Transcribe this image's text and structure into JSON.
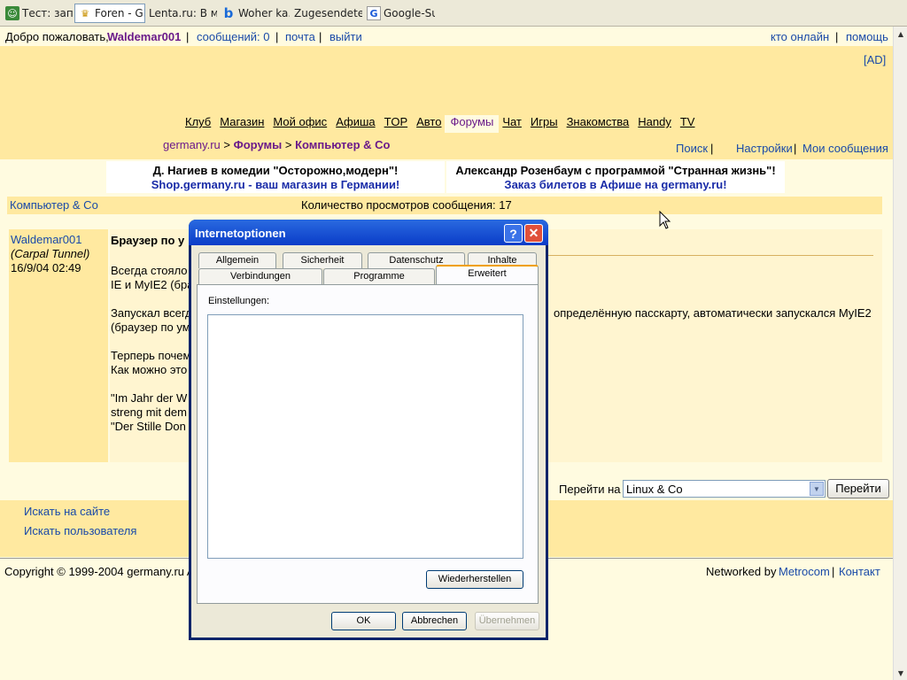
{
  "browser_tabs": [
    {
      "label": "Тест: зап...",
      "icon": "robot-icon"
    },
    {
      "label": "Foren - GE...",
      "icon": "crown-icon",
      "active": true
    },
    {
      "label": "Lenta.ru: В ми...",
      "icon": "blank-icon"
    },
    {
      "label": "Woher ka...",
      "icon": "b-icon"
    },
    {
      "label": "Zugesendete ...",
      "icon": "blank-icon"
    },
    {
      "label": "Google-Su...",
      "icon": "google-icon"
    }
  ],
  "topbar": {
    "welcome": "Добро пожаловать,",
    "username": "Waldemar001",
    "messages": "сообщений: 0",
    "mail": "почта",
    "logout": "выйти",
    "who_online": "кто онлайн",
    "help": "помощь"
  },
  "ad_tag": "[AD]",
  "nav": [
    "Клуб",
    "Магазин",
    "Мой офис",
    "Афиша",
    "TOP",
    "Авто",
    "Форумы",
    "Чат",
    "Игры",
    "Знакомства",
    "Handy",
    "TV"
  ],
  "breadcrumb": {
    "home": "germany.ru",
    "forums": "Форумы",
    "section": "Компьютер & Co"
  },
  "subnav": {
    "search": "Поиск",
    "settings": "Настройки",
    "my_messages": "Мои сообщения"
  },
  "ads": [
    {
      "line1": "Д. Нагиев в комедии \"Осторожно,модерн\"!",
      "line2": "Shop.germany.ru - ваш магазин в Германии!"
    },
    {
      "line1": "Александр Розенбаум с программой \"Странная жизнь\"!",
      "line2": "Заказ билетов в Афише на germany.ru!"
    }
  ],
  "info": {
    "section": "Компьютер & Co",
    "views": "Количество просмотров сообщения: 17"
  },
  "post": {
    "author": "Waldemar001",
    "rank": "(Carpal Tunnel)",
    "date": "16/9/04 02:49",
    "title": "Браузер по у",
    "lines": [
      "Всегда стояло",
      "IE и MyIE2 (бра",
      "",
      "Запускал всегд",
      "(браузер по ум",
      "",
      "Терперь почем",
      "Как можно это",
      "",
      "\"Im Jahr der W",
      "streng mit dem",
      "\"Der Stille Don"
    ],
    "line_right": "определённую пасскарту, автоматически запускался MyIE2"
  },
  "jump": {
    "label": "Перейти на",
    "value": "Linux & Co",
    "button": "Перейти"
  },
  "search": {
    "site": "Искать на сайте",
    "user": "Искать пользователя"
  },
  "footer": {
    "copyright": "Copyright © 1999-2004 germany.ru A",
    "networked": "Networked by",
    "metrocom": "Metrocom",
    "contact": "Контакт"
  },
  "dialog": {
    "title": "Internetoptionen",
    "tabs_row1": [
      "Allgemein",
      "Sicherheit",
      "Datenschutz",
      "Inhalte"
    ],
    "tabs_row2": [
      "Verbindungen",
      "Programme",
      "Erweitert"
    ],
    "settings_label": "Einstellungen:",
    "restore": "Wiederherstellen",
    "ok": "OK",
    "cancel": "Abbrechen",
    "apply": "Übernehmen"
  }
}
